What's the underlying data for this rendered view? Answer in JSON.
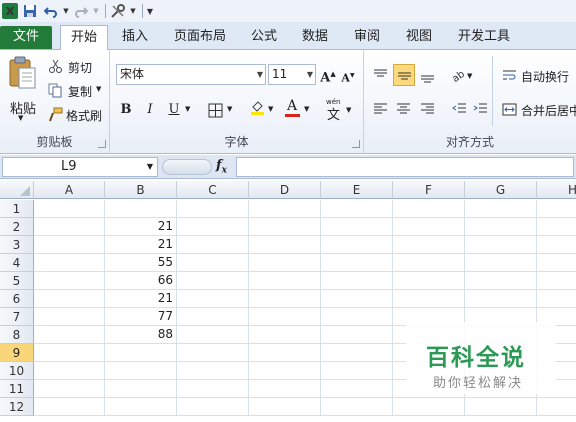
{
  "tabs": [
    "文件",
    "开始",
    "插入",
    "页面布局",
    "公式",
    "数据",
    "审阅",
    "视图",
    "开发工具"
  ],
  "clipboard": {
    "paste": "粘贴",
    "cut": "剪切",
    "copy": "复制",
    "format_painter": "格式刷",
    "label": "剪贴板"
  },
  "font": {
    "name": "宋体",
    "size": "11",
    "bold": "B",
    "italic": "I",
    "underline": "U",
    "label": "字体",
    "grow": "A",
    "shrink": "A",
    "color": "A",
    "wen": "wén"
  },
  "alignment": {
    "wrap_text": "自动换行",
    "merge_center": "合并后居中",
    "label": "对齐方式"
  },
  "name_box": "L9",
  "fx": "fx",
  "columns": [
    "A",
    "B",
    "C",
    "D",
    "E",
    "F",
    "G",
    "H"
  ],
  "rows": [
    "1",
    "2",
    "3",
    "4",
    "5",
    "6",
    "7",
    "8",
    "9",
    "10",
    "11",
    "12"
  ],
  "column_b_values": [
    "",
    "21",
    "21",
    "55",
    "66",
    "21",
    "77",
    "88",
    "",
    "",
    "",
    ""
  ],
  "selected_row": "9",
  "watermark": {
    "title": "百科全说",
    "subtitle": "助你轻松解决"
  },
  "colors": {
    "file_tab": "#237b3a",
    "selection": "#f9d67a",
    "font_color_red": "#d8261c",
    "highlight_yellow": "#ffe600"
  }
}
